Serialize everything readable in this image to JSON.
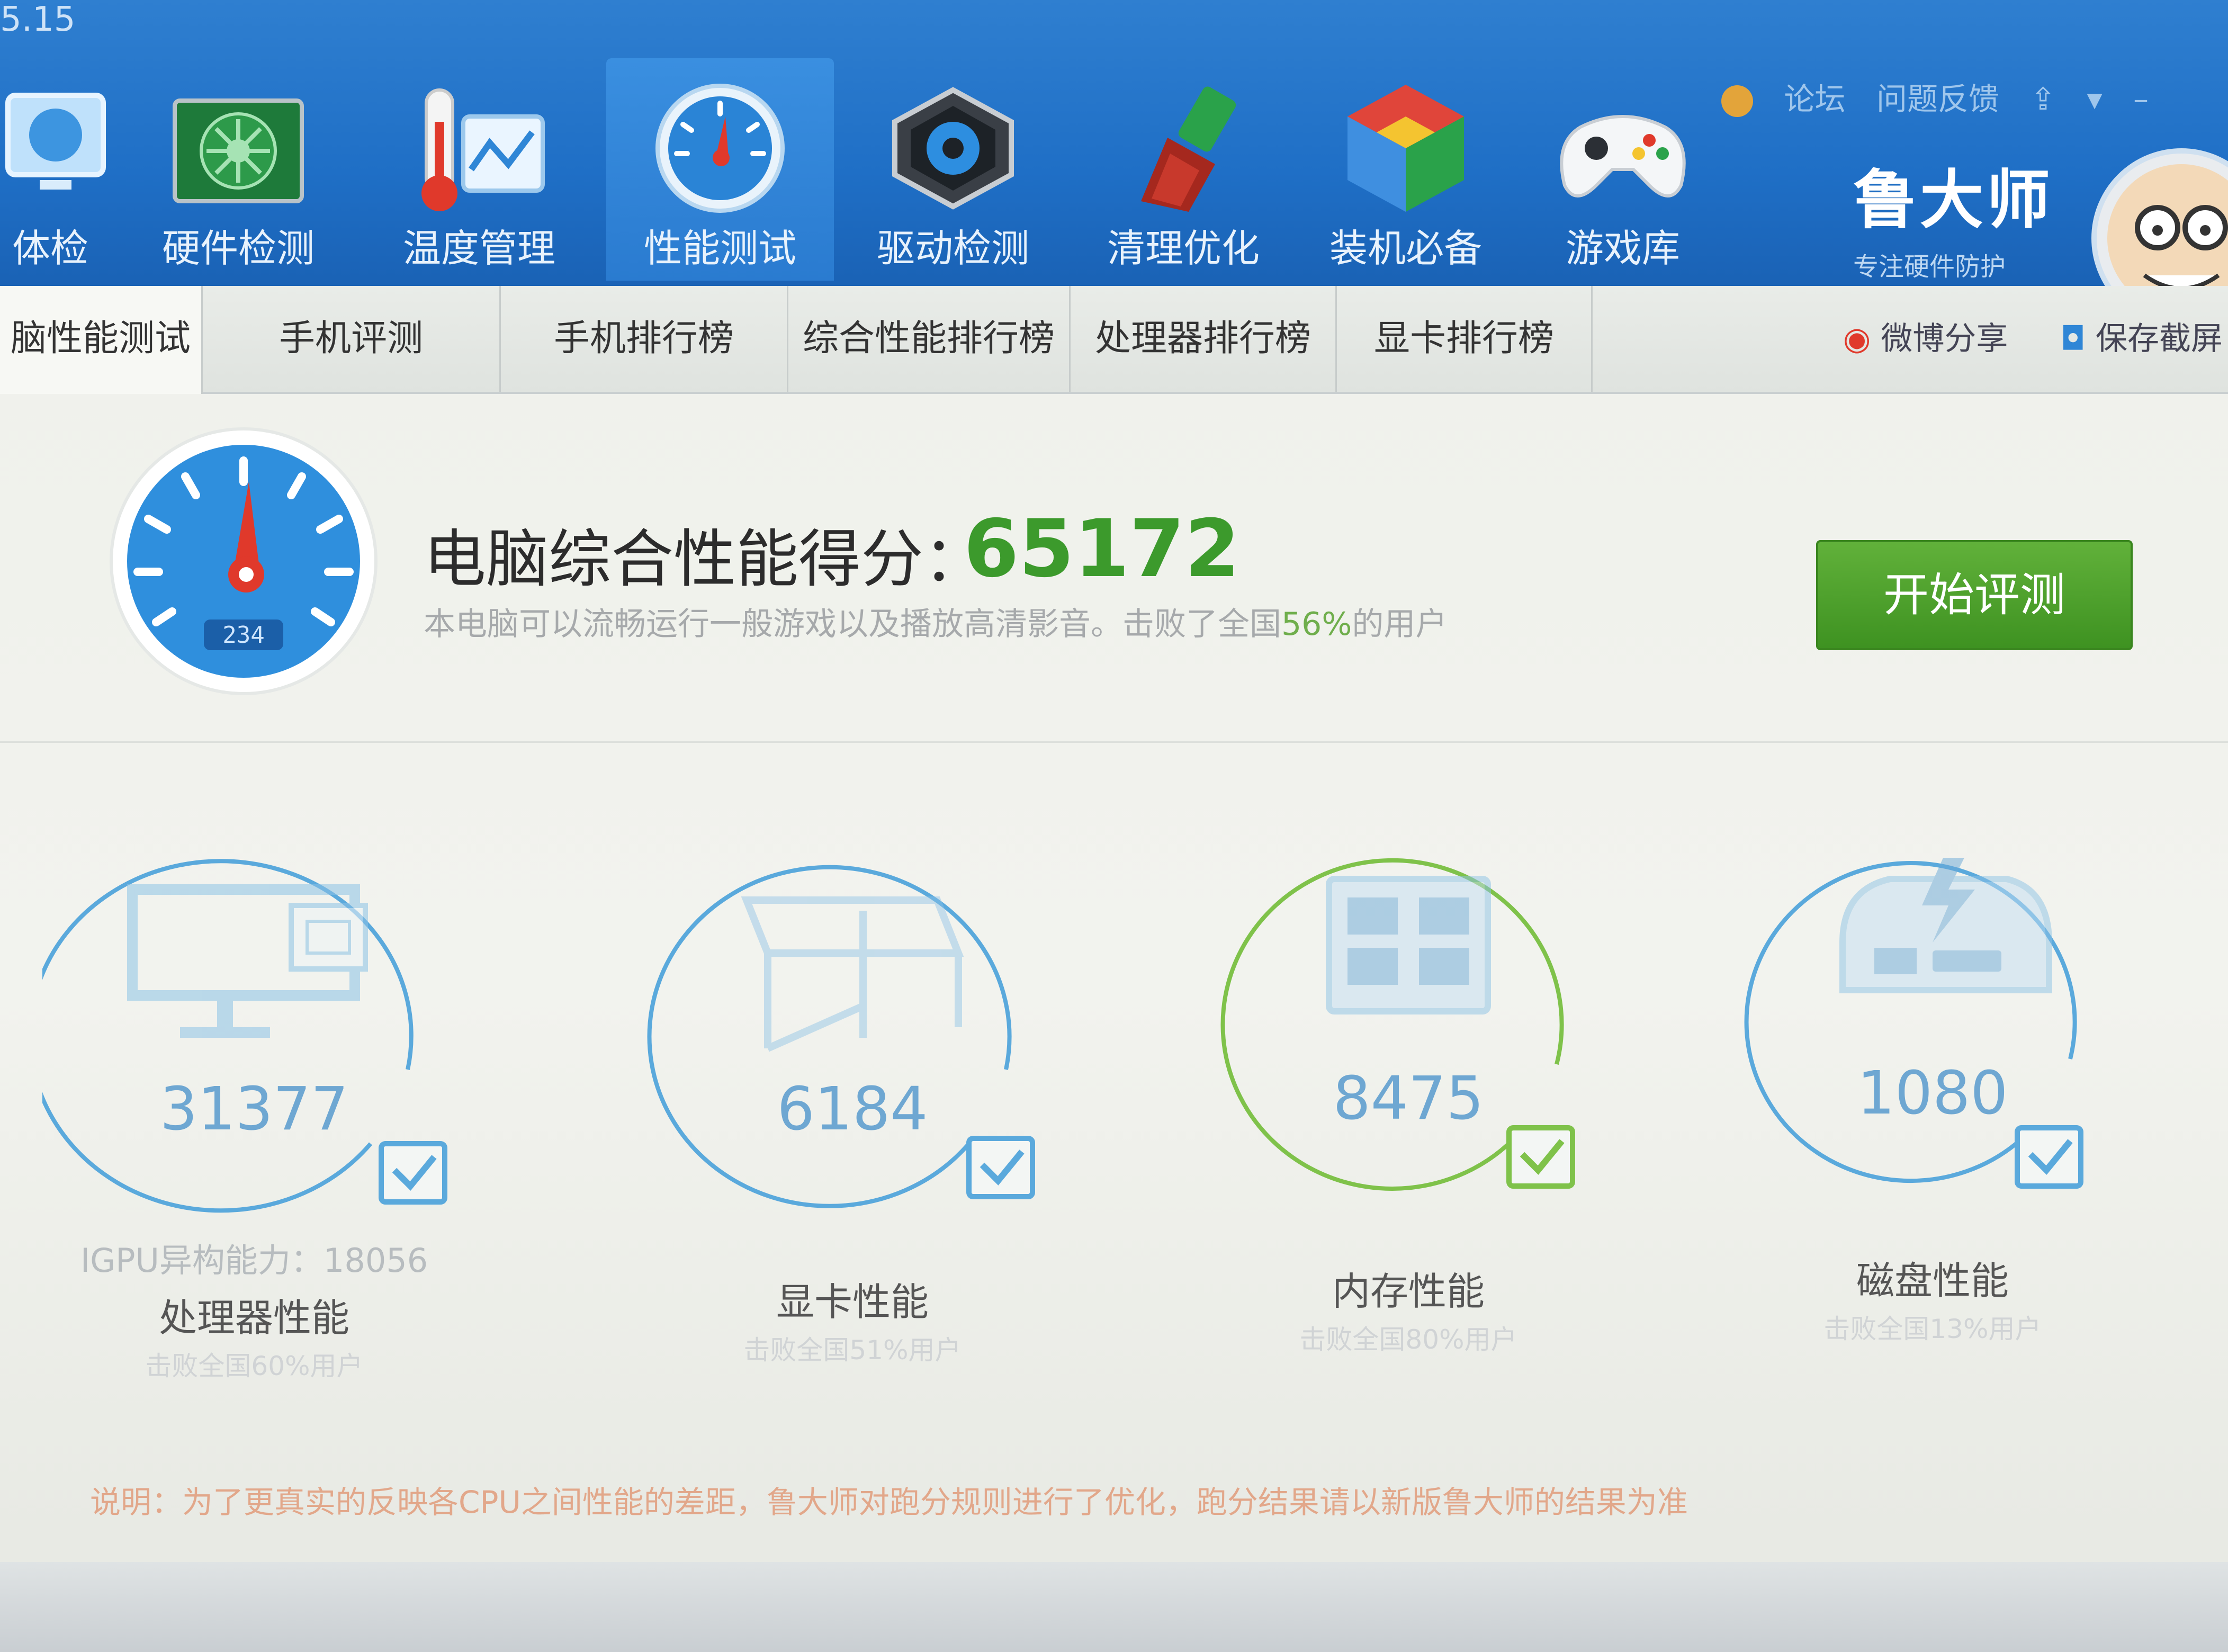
{
  "app": {
    "version": "5.15",
    "top_links": [
      "论坛",
      "问题反馈"
    ],
    "brand_name": "鲁大师",
    "brand_slogan": "专注硬件防护"
  },
  "nav": [
    {
      "label": "体检",
      "icon": "monitor-icon"
    },
    {
      "label": "硬件检测",
      "icon": "graphics-card-icon"
    },
    {
      "label": "温度管理",
      "icon": "thermometer-icon"
    },
    {
      "label": "性能测试",
      "icon": "speedometer-icon",
      "active": true
    },
    {
      "label": "驱动检测",
      "icon": "gear-chip-icon"
    },
    {
      "label": "清理优化",
      "icon": "broom-icon"
    },
    {
      "label": "装机必备",
      "icon": "cube-icon"
    },
    {
      "label": "游戏库",
      "icon": "gamepad-icon"
    }
  ],
  "tabs": [
    {
      "label": "脑性能测试",
      "active": true
    },
    {
      "label": "手机评测"
    },
    {
      "label": "手机排行榜"
    },
    {
      "label": "综合性能排行榜"
    },
    {
      "label": "处理器排行榜"
    },
    {
      "label": "显卡排行榜"
    }
  ],
  "share": {
    "weibo": "微博分享",
    "screenshot": "保存截屏"
  },
  "score": {
    "title": "电脑综合性能得分：",
    "value": "65172",
    "desc_prefix": "本电脑可以流畅运行一般游戏以及播放高清影音。击败了全国",
    "desc_pct": "56%",
    "desc_suffix": "的用户",
    "gauge_digits": "234",
    "start_button": "开始评测"
  },
  "metrics": [
    {
      "value": "31377",
      "extra": "IGPU异构能力：18056",
      "label": "处理器性能",
      "sub": "击败全国60%用户",
      "ring": "#5aa9dc",
      "icon": "cpu-monitor-icon"
    },
    {
      "value": "6184",
      "extra": "",
      "label": "显卡性能",
      "sub": "击败全国51%用户",
      "ring": "#5aa9dc",
      "icon": "graphics-cube-icon"
    },
    {
      "value": "8475",
      "extra": "",
      "label": "内存性能",
      "sub": "击败全国80%用户",
      "ring": "#7fc24a",
      "icon": "memory-chip-icon"
    },
    {
      "value": "1080",
      "extra": "",
      "label": "磁盘性能",
      "sub": "击败全国13%用户",
      "ring": "#5aa9dc",
      "icon": "hard-disk-icon"
    }
  ],
  "note": "说明：为了更真实的反映各CPU之间性能的差距，鲁大师对跑分规则进行了优化，跑分结果请以新版鲁大师的结果为准"
}
